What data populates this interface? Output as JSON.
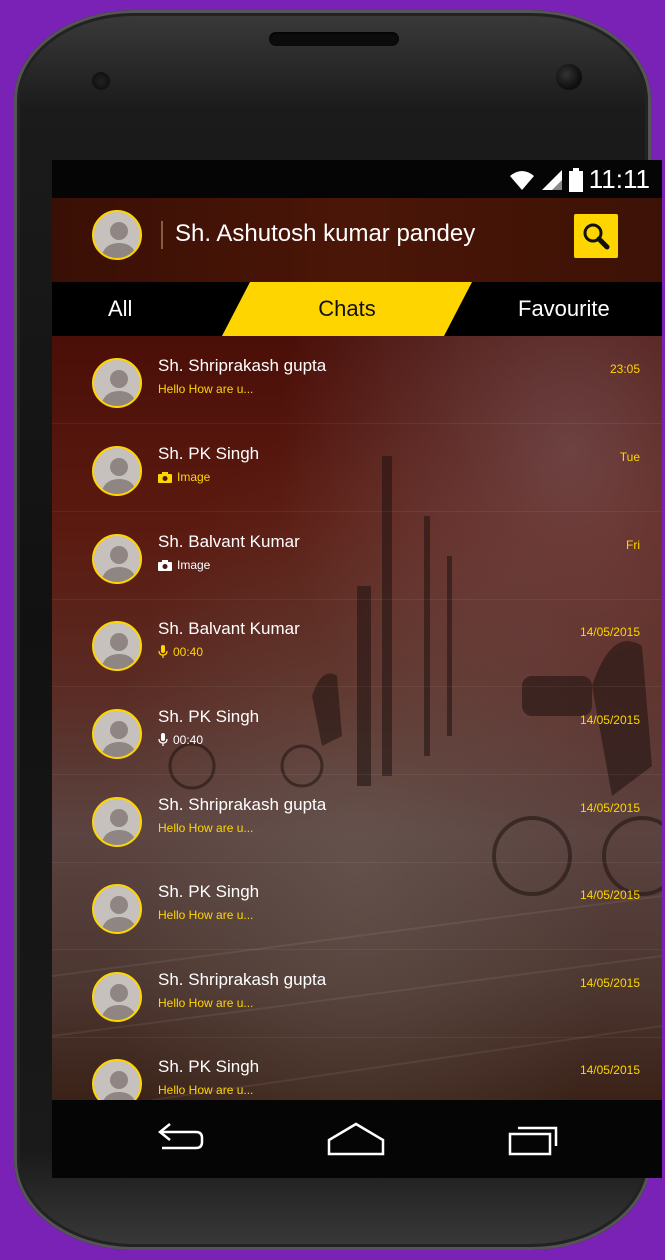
{
  "status": {
    "time": "11:11"
  },
  "header": {
    "user_name": "Sh. Ashutosh kumar pandey"
  },
  "tabs": [
    {
      "label": "All"
    },
    {
      "label": "Chats"
    },
    {
      "label": "Favourite"
    }
  ],
  "chats": [
    {
      "name": "Sh. Shriprakash gupta",
      "message": "Hello How are u...",
      "time": "23:05"
    },
    {
      "name": "Sh. PK Singh",
      "message": "Image",
      "time": "Tue"
    },
    {
      "name": "Sh. Balvant Kumar",
      "message": "Image",
      "time": "Fri"
    },
    {
      "name": "Sh. Balvant Kumar",
      "message": "00:40",
      "time": "14/05/2015"
    },
    {
      "name": "Sh. PK Singh",
      "message": "00:40",
      "time": "14/05/2015"
    },
    {
      "name": "Sh. Shriprakash gupta",
      "message": "Hello How are u...",
      "time": "14/05/2015"
    },
    {
      "name": "Sh. PK Singh",
      "message": "Hello How are u...",
      "time": "14/05/2015"
    },
    {
      "name": "Sh. Shriprakash gupta",
      "message": "Hello How are u...",
      "time": "14/05/2015"
    },
    {
      "name": "Sh. PK Singh",
      "message": "Hello How are u...",
      "time": "14/05/2015"
    }
  ],
  "colors": {
    "accent": "#ffd500",
    "header_bg": "#4a1607",
    "device_bg": "#7b22b6"
  }
}
